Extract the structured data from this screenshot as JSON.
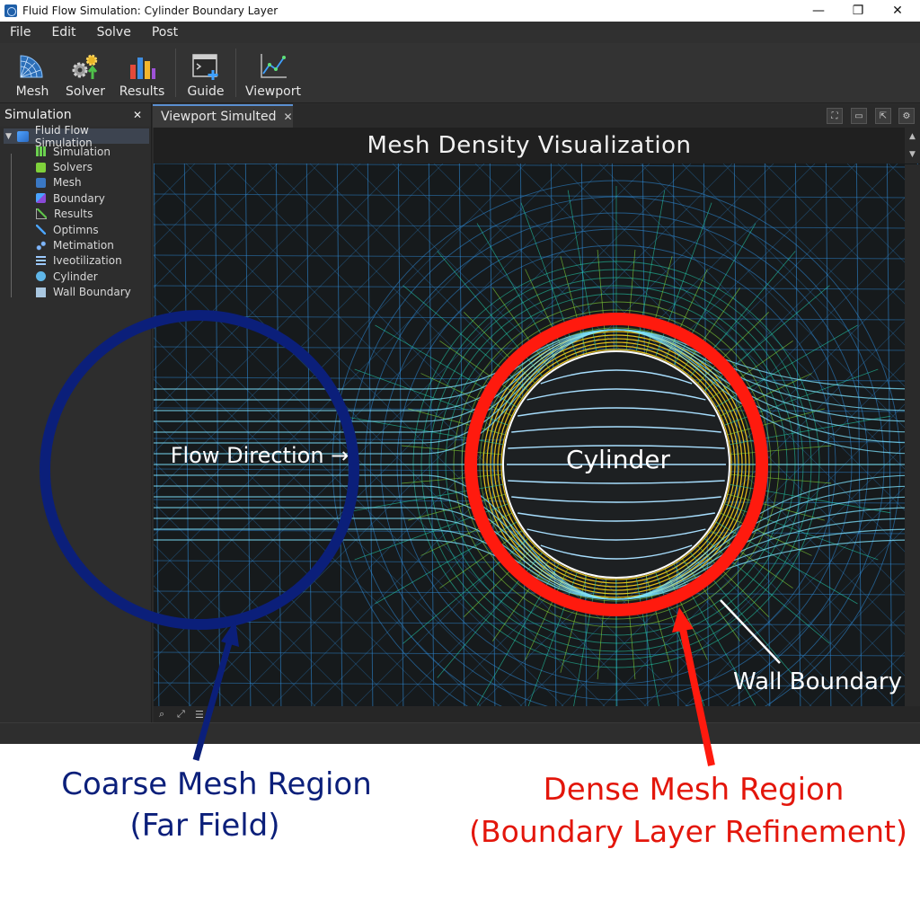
{
  "window": {
    "title": "Fluid Flow Simulation: Cylinder Boundary Layer",
    "minimize": "—",
    "maximize": "❐",
    "close": "✕"
  },
  "menu": [
    "File",
    "Edit",
    "Solve",
    "Post"
  ],
  "toolbar": {
    "mesh": "Mesh",
    "solver": "Solver",
    "results": "Results",
    "guide": "Guide",
    "viewport": "Viewport"
  },
  "panel": {
    "title": "Simulation",
    "close": "✕",
    "root": "Fluid Flow Simulation",
    "items": [
      "Simulation",
      "Solvers",
      "Mesh",
      "Boundary",
      "Results",
      "Optimns",
      "Metimation",
      "Iveotilization",
      "Cylinder",
      "Wall Boundary"
    ]
  },
  "viewport": {
    "tab": "Viewport Simulted",
    "tab_close": "✕",
    "title": "Mesh Density Visualization",
    "labels": {
      "flow": "Flow Direction →",
      "cylinder": "Cylinder",
      "wall": "Wall Boundary"
    }
  },
  "annotations": {
    "coarse_line1": "Coarse Mesh Region",
    "coarse_line2": "(Far Field)",
    "dense_line1": "Dense Mesh Region",
    "dense_line2": "(Boundary Layer Refinement)"
  },
  "colors": {
    "coarse": "#0b1f7a",
    "dense": "#ff1a0e",
    "mesh_far": "#2f8fe0",
    "mesh_mid": "#24d6b0",
    "mesh_near": "#8fe83a",
    "mesh_core": "#ffd21a"
  }
}
